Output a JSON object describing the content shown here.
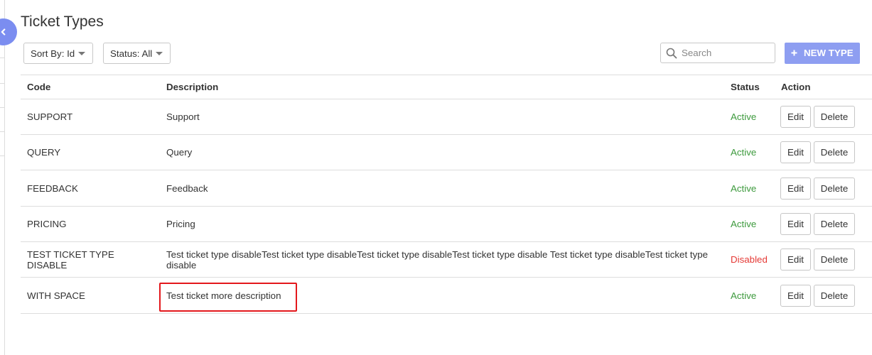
{
  "page": {
    "title": "Ticket Types"
  },
  "toolbar": {
    "sort_by": "Sort By: Id",
    "status_filter": "Status: All",
    "new_type_label": "NEW TYPE"
  },
  "search": {
    "placeholder": "Search",
    "value": ""
  },
  "table": {
    "columns": [
      "Code",
      "Description",
      "Status",
      "Action"
    ],
    "rows": [
      {
        "code": "SUPPORT",
        "description": "Support",
        "status": "Active",
        "actions": [
          "Edit",
          "Delete"
        ]
      },
      {
        "code": "QUERY",
        "description": "Query",
        "status": "Active",
        "actions": [
          "Edit",
          "Delete"
        ]
      },
      {
        "code": "FEEDBACK",
        "description": "Feedback",
        "status": "Active",
        "actions": [
          "Edit",
          "Delete"
        ]
      },
      {
        "code": "PRICING",
        "description": "Pricing",
        "status": "Active",
        "actions": [
          "Edit",
          "Delete"
        ]
      },
      {
        "code": "TEST TICKET TYPE DISABLE",
        "description": "Test ticket type disableTest ticket type disableTest ticket type disableTest ticket type disable Test ticket type disableTest ticket type disable",
        "status": "Disabled",
        "actions": [
          "Edit",
          "Delete"
        ]
      },
      {
        "code": "WITH SPACE",
        "description": "Test ticket more description",
        "status": "Active",
        "actions": [
          "Edit",
          "Delete"
        ]
      }
    ]
  },
  "icons": {
    "sidebar_toggle": "chevron-left-icon",
    "dropdown_caret": "caret-down-icon",
    "search": "search-icon",
    "new_type": "plus-icon"
  },
  "colors": {
    "accent": "#8e9ef1",
    "sidebar_toggle": "#7b8df0",
    "status_active": "#3d9a3d",
    "status_disabled": "#e53935",
    "highlight": "#e3181c",
    "border": "#dddddd",
    "text": "#333333"
  }
}
